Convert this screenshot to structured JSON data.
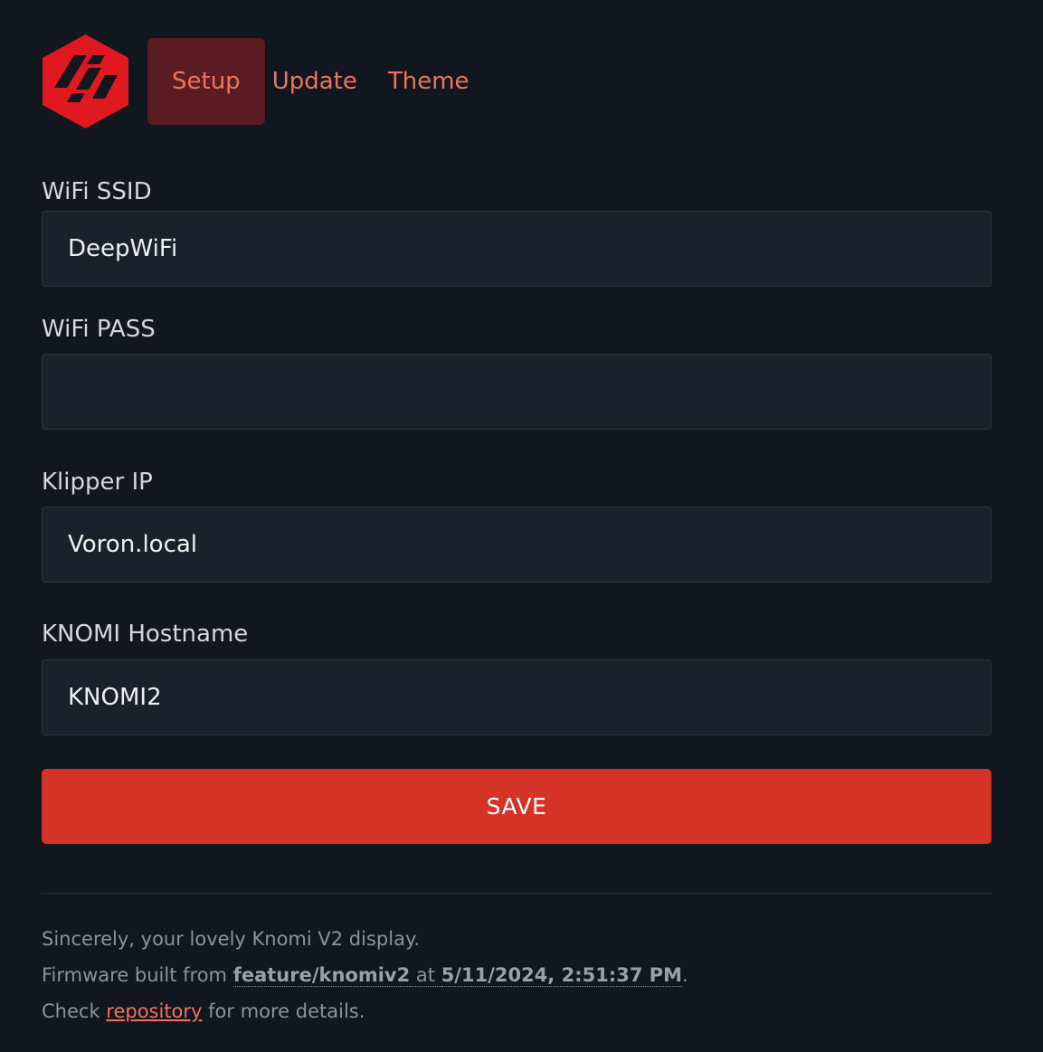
{
  "nav": {
    "logo_icon": "knomi-hexagon-logo-icon",
    "tabs": [
      {
        "label": "Setup",
        "active": true
      },
      {
        "label": "Update",
        "active": false
      },
      {
        "label": "Theme",
        "active": false
      }
    ]
  },
  "form": {
    "ssid": {
      "label": "WiFi SSID",
      "value": "DeepWiFi"
    },
    "pass": {
      "label": "WiFi PASS",
      "value": ""
    },
    "klipper": {
      "label": "Klipper IP",
      "value": "Voron.local"
    },
    "hostname": {
      "label": "KNOMI Hostname",
      "value": "KNOMI2"
    },
    "save_label": "SAVE"
  },
  "footer": {
    "line1": "Sincerely, your lovely Knomi V2 display.",
    "line2_prefix": "Firmware built from ",
    "branch": "feature/knomiv2",
    "line2_mid": " at ",
    "build_time": "5/11/2024, 2:51:37 PM",
    "line2_suffix": ".",
    "line3_prefix": "Check ",
    "repo_link": "repository",
    "line3_suffix": " for more details."
  },
  "colors": {
    "background": "#11161f",
    "accent": "#f0735f",
    "active_tab_bg": "#5a1c22",
    "save_button": "#d63328",
    "logo_red": "#e0181f"
  }
}
